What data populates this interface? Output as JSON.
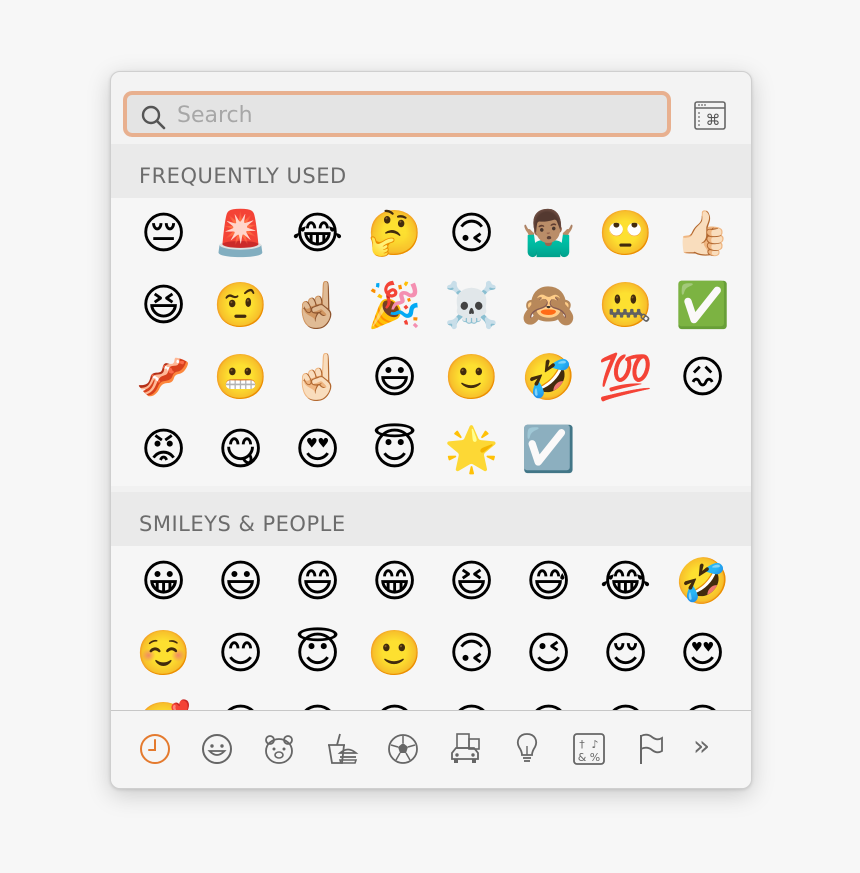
{
  "search": {
    "placeholder": "Search",
    "value": ""
  },
  "viewer_button": {
    "icon": "character-viewer-icon"
  },
  "sections": [
    {
      "id": "frequently-used",
      "title": "FREQUENTLY USED",
      "emojis": [
        {
          "name": "pensive-face",
          "glyph": "😔"
        },
        {
          "name": "police-light",
          "glyph": "🚨"
        },
        {
          "name": "tears-of-joy-face",
          "glyph": "😂"
        },
        {
          "name": "thinking-face",
          "glyph": "🤔"
        },
        {
          "name": "upside-down-face",
          "glyph": "🙃"
        },
        {
          "name": "person-shrugging",
          "glyph": "🤷🏽‍♂️"
        },
        {
          "name": "eye-roll-face",
          "glyph": "🙄"
        },
        {
          "name": "thumbs-up",
          "glyph": "👍🏻"
        },
        {
          "name": "squinting-face",
          "glyph": "😆"
        },
        {
          "name": "raised-eyebrow-face",
          "glyph": "🤨"
        },
        {
          "name": "pointing-up-medium",
          "glyph": "☝🏼"
        },
        {
          "name": "party-popper",
          "glyph": "🎉"
        },
        {
          "name": "skull-crossbones",
          "glyph": "☠️"
        },
        {
          "name": "see-no-evil-monkey",
          "glyph": "🙈"
        },
        {
          "name": "zipper-mouth-face",
          "glyph": "🤐"
        },
        {
          "name": "check-mark-button",
          "glyph": "✅"
        },
        {
          "name": "bacon",
          "glyph": "🥓"
        },
        {
          "name": "grimacing-face",
          "glyph": "😬"
        },
        {
          "name": "pointing-up-light",
          "glyph": "☝🏻"
        },
        {
          "name": "smiley-face",
          "glyph": "😃"
        },
        {
          "name": "slightly-smiling-face",
          "glyph": "🙂"
        },
        {
          "name": "rolling-laughing-face",
          "glyph": "🤣"
        },
        {
          "name": "hundred-points",
          "glyph": "💯"
        },
        {
          "name": "confounded-face",
          "glyph": "😖"
        },
        {
          "name": "pouting-face",
          "glyph": "😡"
        },
        {
          "name": "yum-face",
          "glyph": "😋"
        },
        {
          "name": "heart-eyes-face",
          "glyph": "😍"
        },
        {
          "name": "halo-face",
          "glyph": "😇"
        },
        {
          "name": "glowing-star",
          "glyph": "🌟"
        },
        {
          "name": "check-box",
          "glyph": "☑️"
        }
      ]
    },
    {
      "id": "smileys-people",
      "title": "SMILEYS & PEOPLE",
      "emojis": [
        {
          "name": "grinning-face",
          "glyph": "😀"
        },
        {
          "name": "smiley-face",
          "glyph": "😃"
        },
        {
          "name": "smile-face",
          "glyph": "😄"
        },
        {
          "name": "beaming-face",
          "glyph": "😁"
        },
        {
          "name": "squinting-face",
          "glyph": "😆"
        },
        {
          "name": "sweat-smile-face",
          "glyph": "😅"
        },
        {
          "name": "tears-of-joy-face",
          "glyph": "😂"
        },
        {
          "name": "rolling-laughing-face",
          "glyph": "🤣"
        },
        {
          "name": "relaxed-face",
          "glyph": "☺️"
        },
        {
          "name": "blush-face",
          "glyph": "😊"
        },
        {
          "name": "halo-face",
          "glyph": "😇"
        },
        {
          "name": "slightly-smiling-face",
          "glyph": "🙂"
        },
        {
          "name": "upside-down-face",
          "glyph": "🙃"
        },
        {
          "name": "winking-face",
          "glyph": "😉"
        },
        {
          "name": "relieved-face",
          "glyph": "😌"
        },
        {
          "name": "heart-eyes-face",
          "glyph": "😍"
        },
        {
          "name": "smiling-hearts-face",
          "glyph": "🥰"
        },
        {
          "name": "kissing-heart-face",
          "glyph": "😘"
        },
        {
          "name": "kissing-face",
          "glyph": "😗"
        },
        {
          "name": "kissing-smiling-eyes-face",
          "glyph": "😙"
        },
        {
          "name": "kissing-closed-eyes-face",
          "glyph": "😚"
        },
        {
          "name": "yum-face",
          "glyph": "😋"
        },
        {
          "name": "tongue-face",
          "glyph": "😛"
        },
        {
          "name": "squinting-tongue-face",
          "glyph": "😝"
        }
      ]
    }
  ],
  "categories": [
    {
      "name": "recent-icon",
      "active": true
    },
    {
      "name": "smileys-icon",
      "active": false
    },
    {
      "name": "animals-icon",
      "active": false
    },
    {
      "name": "food-icon",
      "active": false
    },
    {
      "name": "activity-icon",
      "active": false
    },
    {
      "name": "travel-icon",
      "active": false
    },
    {
      "name": "objects-icon",
      "active": false
    },
    {
      "name": "symbols-icon",
      "active": false
    },
    {
      "name": "flags-icon",
      "active": false
    }
  ],
  "more_label": "»",
  "colors": {
    "accent": "#e47a2e",
    "search_ring": "#e8b08f",
    "icon_gray": "#6a6a6a"
  }
}
